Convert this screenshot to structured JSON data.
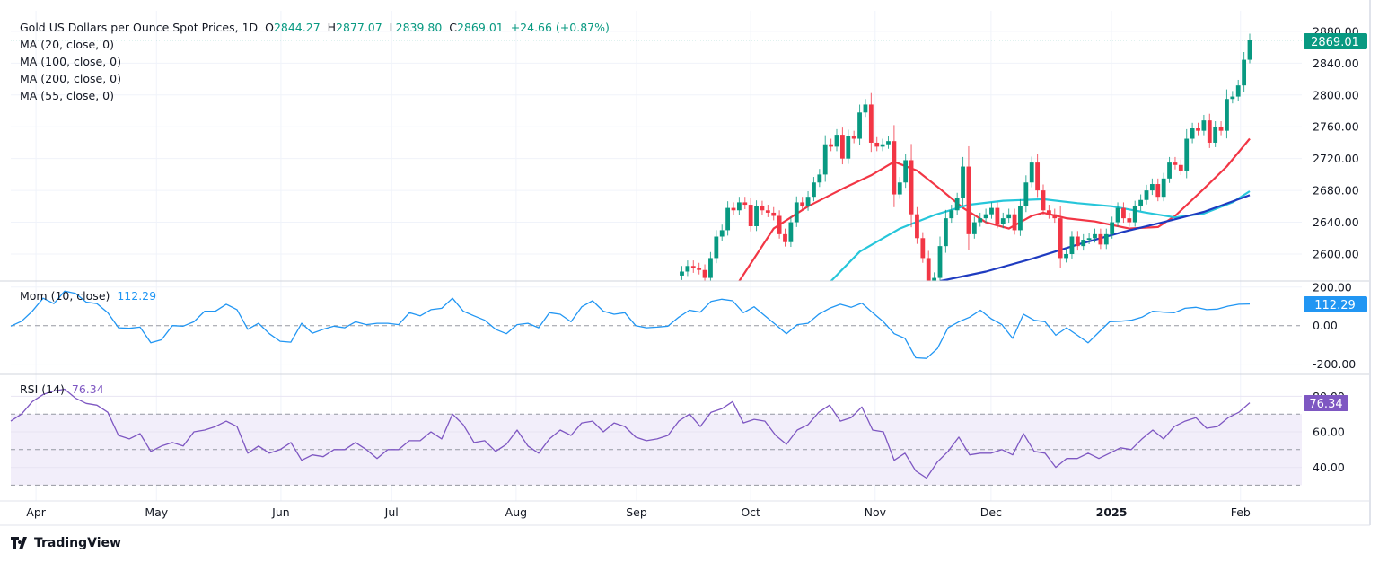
{
  "header": {
    "symbol": "Gold US Dollars per Ounce Spot Prices, 1D",
    "o_label": "O",
    "o_value": "2844.27",
    "h_label": "H",
    "h_value": "2877.07",
    "l_label": "L",
    "l_value": "2839.80",
    "c_label": "C",
    "c_value": "2869.01",
    "change": "+24.66 (+0.87%)"
  },
  "ma_legend": [
    "MA (20, close, 0)",
    "MA (100, close, 0)",
    "MA (200, close, 0)",
    "MA (55, close, 0)"
  ],
  "momentum": {
    "title": "Mom (10, close)",
    "value": "112.29"
  },
  "rsi": {
    "title": "RSI (14)",
    "value": "76.34"
  },
  "price_label": "2869.01",
  "branding": "TradingView",
  "colors": {
    "up": "#089981",
    "down": "#f23645",
    "ma_red": "#f23645",
    "ma_cyan": "#26c6da",
    "ma_blue": "#1e3bc0",
    "mom": "#2196f3",
    "rsi": "#7e57c2",
    "rsi_band": "#f2eefa"
  },
  "chart_data": [
    {
      "type": "candlestick",
      "title": "Gold US Dollars per Ounce Spot Prices, 1D",
      "x_axis": {
        "unit": "trading day index",
        "range": [
          0,
          216
        ],
        "ticks": [
          {
            "label": "Apr",
            "i": 4.4
          },
          {
            "label": "May",
            "i": 25.4
          },
          {
            "label": "Jun",
            "i": 47.1
          },
          {
            "label": "Jul",
            "i": 66.4
          },
          {
            "label": "Aug",
            "i": 88.1
          },
          {
            "label": "Sep",
            "i": 109.1
          },
          {
            "label": "Oct",
            "i": 129
          },
          {
            "label": "Nov",
            "i": 150.7
          },
          {
            "label": "Dec",
            "i": 170.9
          },
          {
            "label": "2025",
            "i": 191.9,
            "bold": true
          },
          {
            "label": "Feb",
            "i": 214.4
          }
        ]
      },
      "y_axis": {
        "range": [
          2566,
          2905
        ],
        "ticks": [
          "2600.00",
          "2640.00",
          "2680.00",
          "2720.00",
          "2760.00",
          "2800.00",
          "2840.00",
          "2880.00"
        ]
      },
      "first_candle_index": 117,
      "closes": [
        2578,
        2585,
        2582,
        2580,
        2570,
        2595,
        2622,
        2630,
        2658,
        2655,
        2665,
        2662,
        2635,
        2660,
        2655,
        2652,
        2648,
        2625,
        2615,
        2640,
        2665,
        2660,
        2672,
        2690,
        2700,
        2738,
        2735,
        2750,
        2720,
        2748,
        2745,
        2778,
        2788,
        2740,
        2735,
        2738,
        2742,
        2675,
        2690,
        2718,
        2650,
        2620,
        2595,
        2565,
        2570,
        2610,
        2645,
        2655,
        2670,
        2710,
        2625,
        2640,
        2645,
        2650,
        2658,
        2638,
        2645,
        2650,
        2630,
        2660,
        2690,
        2715,
        2680,
        2655,
        2650,
        2645,
        2595,
        2600,
        2622,
        2610,
        2618,
        2620,
        2625,
        2612,
        2625,
        2640,
        2658,
        2645,
        2640,
        2660,
        2668,
        2680,
        2688,
        2672,
        2695,
        2715,
        2712,
        2705,
        2745,
        2758,
        2755,
        2768,
        2740,
        2760,
        2755,
        2795,
        2798,
        2812,
        2844.27,
        2869.01
      ],
      "last_candle": {
        "open": 2844.27,
        "high": 2877.07,
        "low": 2839.8,
        "close": 2869.01
      },
      "moving_averages": [
        {
          "name": "MA 20",
          "color_key": "ma_red",
          "points": [
            [
              127,
              2566
            ],
            [
              133,
              2632
            ],
            [
              139,
              2660
            ],
            [
              145,
              2682
            ],
            [
              150,
              2699
            ],
            [
              154,
              2716
            ],
            [
              158,
              2705
            ],
            [
              162,
              2682
            ],
            [
              166,
              2658
            ],
            [
              170,
              2640
            ],
            [
              174,
              2632
            ],
            [
              178,
              2648
            ],
            [
              180,
              2652
            ],
            [
              184,
              2645
            ],
            [
              189,
              2641
            ],
            [
              195,
              2632
            ],
            [
              200,
              2634
            ],
            [
              203,
              2648
            ],
            [
              208,
              2682
            ],
            [
              212,
              2710
            ],
            [
              216,
              2745
            ]
          ]
        },
        {
          "name": "MA 55",
          "color_key": "ma_cyan",
          "points": [
            [
              143,
              2566
            ],
            [
              148,
              2603
            ],
            [
              155,
              2632
            ],
            [
              161,
              2649
            ],
            [
              167,
              2662
            ],
            [
              173,
              2667
            ],
            [
              180,
              2669
            ],
            [
              186,
              2664
            ],
            [
              192,
              2660
            ],
            [
              198,
              2652
            ],
            [
              203,
              2646
            ],
            [
              208,
              2651
            ],
            [
              213,
              2665
            ],
            [
              216,
              2679
            ]
          ]
        },
        {
          "name": "MA 100",
          "color_key": "ma_blue",
          "points": [
            [
              162,
              2566
            ],
            [
              170,
              2578
            ],
            [
              178,
              2594
            ],
            [
              186,
              2612
            ],
            [
              194,
              2628
            ],
            [
              202,
              2642
            ],
            [
              208,
              2653
            ],
            [
              216,
              2674
            ]
          ]
        }
      ],
      "current_price": 2869.01
    },
    {
      "type": "line",
      "title": "Mom (10, close)",
      "y_axis": {
        "range": [
          -200,
          200
        ],
        "ticks": [
          "200.00",
          "0.00",
          "-200.00"
        ]
      },
      "x_range": [
        0,
        216
      ],
      "values": [
        -3,
        23,
        75,
        142,
        114,
        179,
        168,
        122,
        114,
        67,
        -11,
        -14,
        -8,
        -89,
        -73,
        0,
        -3,
        20,
        75,
        75,
        111,
        83,
        -19,
        12,
        -42,
        -81,
        -86,
        12,
        -39,
        -19,
        -3,
        -11,
        20,
        5,
        12,
        12,
        5,
        67,
        51,
        83,
        90,
        142,
        75,
        51,
        28,
        -19,
        -42,
        5,
        12,
        -11,
        67,
        59,
        20,
        98,
        129,
        75,
        59,
        67,
        0,
        -11,
        -8,
        -3,
        44,
        80,
        70,
        126,
        137,
        129,
        67,
        98,
        51,
        5,
        -42,
        5,
        12,
        59,
        90,
        111,
        95,
        117,
        67,
        20,
        -42,
        -66,
        -167,
        -170,
        -120,
        -11,
        20,
        44,
        80,
        36,
        5,
        -66,
        59,
        28,
        20,
        -50,
        -11,
        -50,
        -89,
        -34,
        20,
        23,
        28,
        44,
        75,
        70,
        67,
        90,
        95,
        83,
        86,
        101,
        111,
        112.29
      ]
    },
    {
      "type": "line",
      "title": "RSI (14)",
      "y_axis": {
        "range": [
          25,
          85
        ],
        "ticks": [
          "80.00",
          "60.00",
          "40.00"
        ],
        "bands": [
          70,
          50,
          30
        ]
      },
      "x_range": [
        0,
        216
      ],
      "values": [
        66,
        70,
        77,
        81,
        83,
        84,
        79,
        76,
        75,
        71,
        58,
        56,
        59,
        49,
        52,
        54,
        52,
        60,
        61,
        63,
        66,
        63,
        48,
        52,
        48,
        50,
        54,
        44,
        47,
        46,
        50,
        50,
        54,
        50,
        45,
        50,
        50,
        55,
        55,
        60,
        56,
        70,
        64,
        54,
        55,
        49,
        53,
        61,
        52,
        48,
        56,
        61,
        58,
        65,
        66,
        60,
        65,
        63,
        57,
        55,
        56,
        58,
        66,
        70,
        63,
        71,
        73,
        77,
        65,
        67,
        66,
        58,
        53,
        61,
        64,
        71,
        75,
        66,
        68,
        74,
        61,
        60,
        44,
        48,
        38,
        34,
        43,
        49,
        57,
        47,
        48,
        48,
        50,
        47,
        59,
        49,
        48,
        40,
        45,
        45,
        48,
        45,
        48,
        51,
        50,
        56,
        61,
        56,
        63,
        66,
        68,
        62,
        63,
        68,
        71,
        76.34
      ]
    }
  ]
}
